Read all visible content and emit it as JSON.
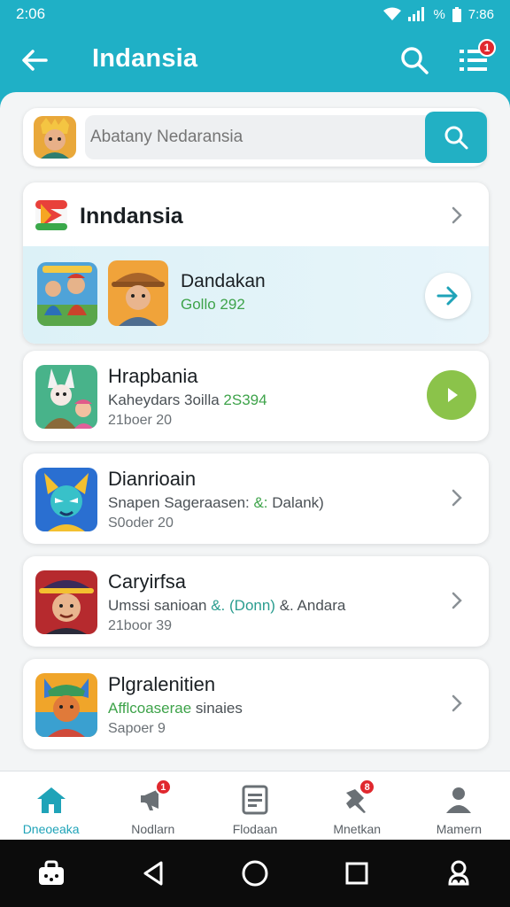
{
  "status_bar": {
    "time": "2:06",
    "battery_text": "%",
    "clock_right": "7:86"
  },
  "app_bar": {
    "title": "Indansia",
    "list_badge": "1",
    "accent": "#1fb0c6"
  },
  "search": {
    "placeholder": "Abatany Nedaransia",
    "avatar_icon": "hero-avatar"
  },
  "featured": {
    "title": "Inndansia",
    "item_name": "Dandakan",
    "item_sub": "Gollo 292"
  },
  "items": [
    {
      "title": "Hrapbania",
      "sub_parts": [
        "Kaheydars 3oilla ",
        "2S394"
      ],
      "meta": "21boer 20",
      "action": "play"
    },
    {
      "title": "Dianrioain",
      "sub_parts": [
        "Snapen Sageraasen: ",
        "&:",
        " Dalank)"
      ],
      "meta": "S0oder 20",
      "action": "chevron"
    },
    {
      "title": "Caryirfsa",
      "sub_parts": [
        "Umssi sanioan ",
        "&. (Donn)",
        " &. Andara"
      ],
      "meta": "21boor 39",
      "action": "chevron"
    },
    {
      "title": "Plgralenitien",
      "sub_parts": [
        "Afflcoaserae",
        " sinaies"
      ],
      "meta": "Sapoer 9",
      "action": "chevron"
    }
  ],
  "bottom_nav": [
    {
      "label": "Dneoeaka",
      "icon": "home-icon",
      "active": true,
      "badge": ""
    },
    {
      "label": "Nodlarn",
      "icon": "megaphone-icon",
      "active": false,
      "badge": "1"
    },
    {
      "label": "Flodaan",
      "icon": "document-icon",
      "active": false,
      "badge": ""
    },
    {
      "label": "Mnetkan",
      "icon": "pin-icon",
      "active": false,
      "badge": "8"
    },
    {
      "label": "Mamern",
      "icon": "person-icon",
      "active": false,
      "badge": ""
    }
  ],
  "colors": {
    "primary": "#1fb0c6",
    "badge": "#e0282e",
    "play": "#8bc34a",
    "highlight_green": "#3ea34a"
  }
}
